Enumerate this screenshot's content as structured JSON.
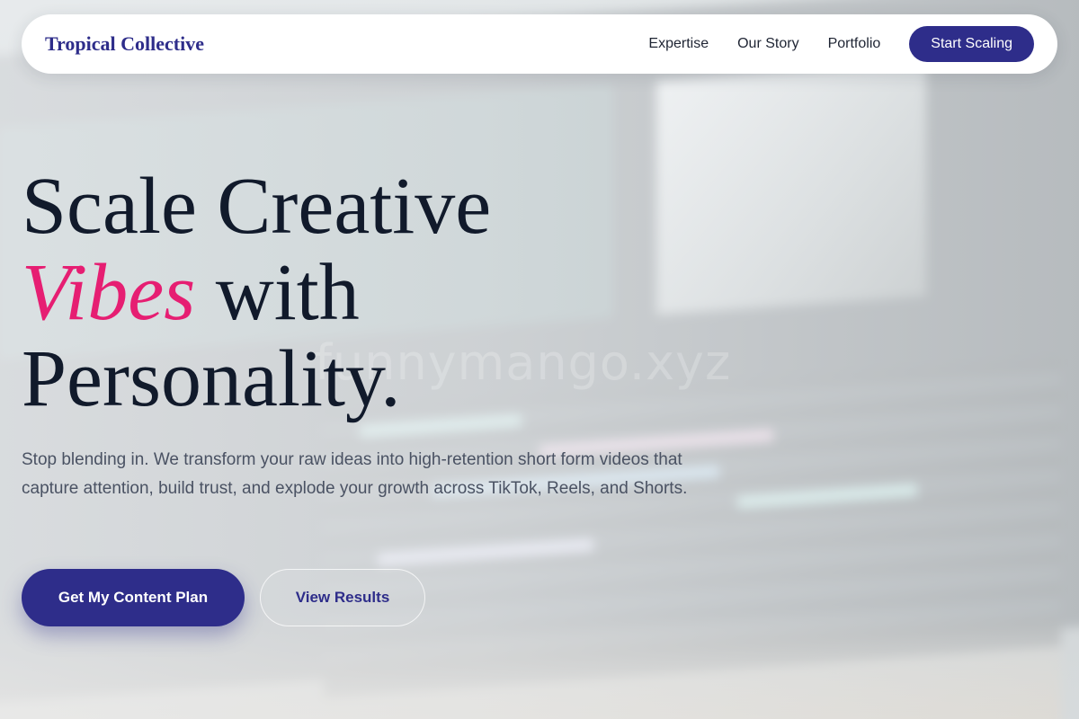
{
  "nav": {
    "brand": "Tropical Collective",
    "links": [
      "Expertise",
      "Our Story",
      "Portfolio"
    ],
    "cta": "Start Scaling"
  },
  "hero": {
    "title_line1": "Scale Creative",
    "title_accent": "Vibes",
    "title_line2_rest": "with",
    "title_line3": "Personality.",
    "subtitle": "Stop blending in. We transform your raw ideas into high-retention short form videos that capture attention, build trust, and explode your growth across TikTok, Reels, and Shorts.",
    "primary_button": "Get My Content Plan",
    "secondary_button": "View Results"
  },
  "watermark": "funnymango.xyz",
  "colors": {
    "brand_navy": "#2e2d8a",
    "accent_pink": "#e61e72",
    "heading": "#111a2b",
    "body_text": "#4a5263"
  }
}
